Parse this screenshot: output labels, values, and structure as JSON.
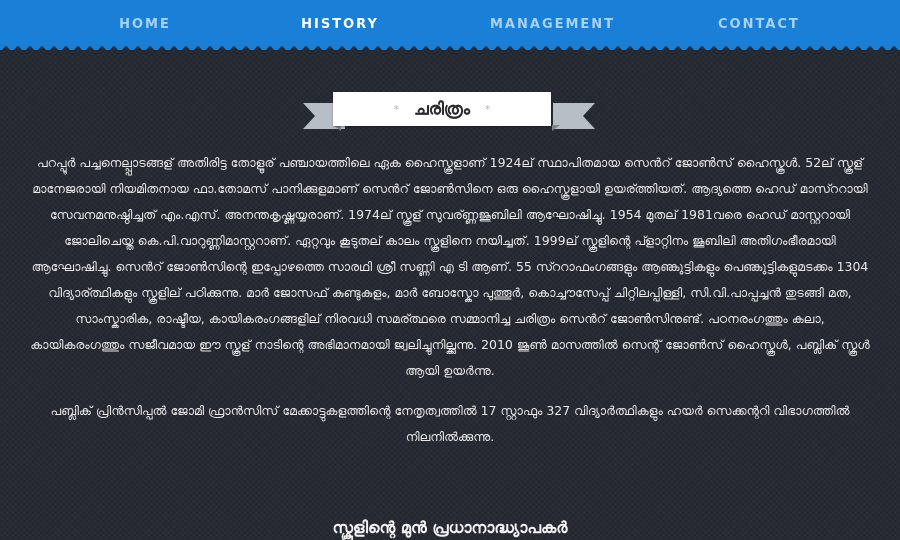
{
  "nav": {
    "items": [
      {
        "label": "HOME"
      },
      {
        "label": "HISTORY"
      },
      {
        "label": "MANAGEMENT"
      },
      {
        "label": "CONTACT"
      }
    ],
    "active": "HISTORY"
  },
  "banner": {
    "star_left": "*",
    "title": "ചരിത്രം",
    "star_right": "*"
  },
  "content": {
    "paragraphs": [
      "പറപ്പൂർ പച്ചനെല്പ്പാടങ്ങള് അതിരിട്ട തോളൂര് പഞ്ചായത്തിലെ ഏക ഹൈസ്കൂളാണ് 1924ല് സ്ഥാപിതമായ സെൻറ് ജോൺസ് ഹൈസ്കൂൾ. 52ല് സ്കൂള് മാനേജരായി നിയമിതനായ ഫാ.തോമസ് പാനിക്കുളമാണ് സെൻറ് ജോൺസിനെ ഒരു ഹൈസ്കൂളായി ഉയര്ത്തിയത്. ആദ്യത്തെ ഹെഡ് മാസ്ററായി സേവനമനുഷ്ഠിച്ചത് എം.എസ്. അനന്തകൃഷ്ണയ്യരാണ്. 1974ല് സ്കൂള് സുവര്ണ്ണജൂബിലി ആഘോഷിച്ചു. 1954 മുതല് 1981വരെ ഹെഡ് മാസ്റ്ററായി ജോലിചെയ്ത കെ.പി.വാറുണ്ണിമാസ്റ്ററാണ്. ഏറ്റവും കൂടുതല് കാലം സ്കൂളിനെ നയിച്ചത്. 1999ല് സ്കൂളിന്റെ പ്ളാറ്റിനം ജൂബിലി അതിഗംഭീരമായി ആഘോഷിച്ചു. സെൻറ് ജോൺസിന്റെ ഇപ്പോഴത്തെ സാരഥി ശ്രീ സണ്ണി എ ടി ആണ്. 55 സ്ററാഫംഗങ്ങളും ആണ്കുട്ടികളും പെണ്കുട്ടികളുമടക്കം 1304 വിദ്യാര്ത്ഥികളും സ്കൂളില് പഠിക്കുന്നു. മാർ ജോസഫ് കുണ്ടുകുളം, മാർ ബോസ്കോ പുത്തൂർ, കൊച്ചൗസേപ്പ് ചിറ്റിലപ്പിള്ളി, സി.വി.പാപ്പച്ചൻ തുടങ്ങി മത, സാംസ്കാരിക, രാഷ്ടീയ, കായികരംഗങ്ങളില് നിരവധി സമര്ത്ഥരെ സമ്മാനിച്ച ചരിത്രം സെൻറ് ജോൺസിനുണ്ട്. പഠനരംഗത്തും കലാ, കായികരംഗത്തും സജീവമായ ഈ സ്കൂള് നാടിന്റെ അഭിമാനമായി ജ്വലിച്ചുനില്ക്കുന്നു. 2010 ജൂൺ മാസത്തിൽ സെന്റ് ജോൺസ് ഹൈസ്കൂൾ, പബ്ലിക് സ്കൂൾ ആയി ഉയർന്നു.",
      "പബ്ലിക് പ്രിൻസിപ്പൽ ജോമി ഫ്രാൻസിസ് മേക്കാട്ടുകളത്തിന്റെ നേതൃത്വത്തിൽ 17 സ്റ്റാഫും 327 വിദ്യാർത്ഥികളും ഹയർ സെക്കന്ററി വിഭാഗത്തിൽ നിലനിൽക്കുന്നു."
    ],
    "section_heading": "സ്കൂളിന്റെ മുൻ പ്രധാനാദ്ധ്യാപകർ"
  },
  "colors": {
    "navbar": "#1a7fd6",
    "nav_text": "#a9d2f5",
    "nav_active": "#ffffff",
    "background": "#262a33",
    "ribbon": "#ffffff",
    "ribbon_tail": "#b8bec6"
  }
}
